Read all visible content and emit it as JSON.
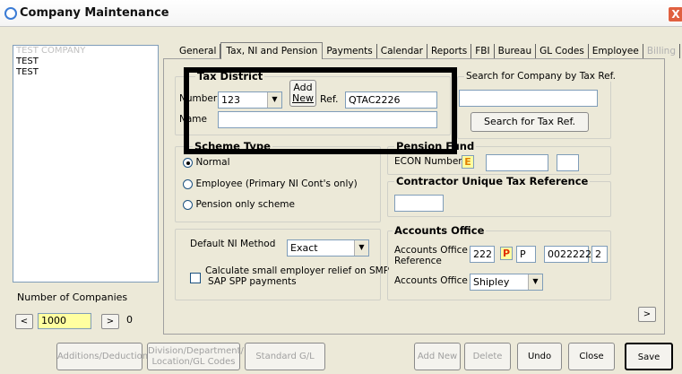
{
  "window": {
    "title": "Company Maintenance",
    "close_glyph": "X"
  },
  "company_list": {
    "items": [
      "TEST COMPANY",
      "TEST",
      "TEST"
    ]
  },
  "number_of_companies": {
    "label": "Number of Companies",
    "value": "1000",
    "count": "0",
    "prev": "<",
    "next": ">"
  },
  "tabs": [
    {
      "label": "General"
    },
    {
      "label": "Tax, NI and Pension"
    },
    {
      "label": "Payments"
    },
    {
      "label": "Calendar"
    },
    {
      "label": "Reports"
    },
    {
      "label": "FBI"
    },
    {
      "label": "Bureau"
    },
    {
      "label": "GL Codes"
    },
    {
      "label": "Employee"
    },
    {
      "label": "Billing"
    }
  ],
  "tax_district": {
    "title": "Tax District",
    "number_label": "Number",
    "number_value": "123",
    "add_new_line1": "Add",
    "add_new_line2": "New",
    "ref_label": "Ref.",
    "ref_value": "QTAC2226",
    "name_label": "Name",
    "name_value": ""
  },
  "search": {
    "title": "Search for Company by Tax Ref.",
    "value": "",
    "button": "Search for Tax Ref."
  },
  "scheme_type": {
    "title": "Scheme Type",
    "options": [
      "Normal",
      "Employee (Primary NI Cont's only)",
      "Pension only scheme"
    ]
  },
  "pension_fund": {
    "title": "Pension Fund",
    "econ_label": "ECON Number",
    "econ_badge": "E"
  },
  "contractor": {
    "title": "Contractor Unique Tax Reference"
  },
  "ni": {
    "default_label": "Default NI Method",
    "default_value": "Exact",
    "smp_label_1": "Calculate small employer relief on SMP",
    "smp_label_2": "SAP SPP payments"
  },
  "accounts_office": {
    "title": "Accounts Office",
    "ref_label_1": "Accounts Office",
    "ref_label_2": "Reference",
    "ref_part1": "222",
    "ref_badge": "P",
    "ref_part2": "P",
    "ref_part3": "0022222",
    "ref_part4": "2",
    "office_label": "Accounts Office",
    "office_value": "Shipley"
  },
  "scroll_next": ">",
  "buttons": {
    "additions": "Additions/Deductions",
    "division_1": "Division/Department/",
    "division_2": "Location/GL Codes",
    "standard": "Standard G/L Codes",
    "add_new": "Add New",
    "delete": "Delete",
    "undo": "Undo",
    "close": "Close",
    "save": "Save"
  }
}
